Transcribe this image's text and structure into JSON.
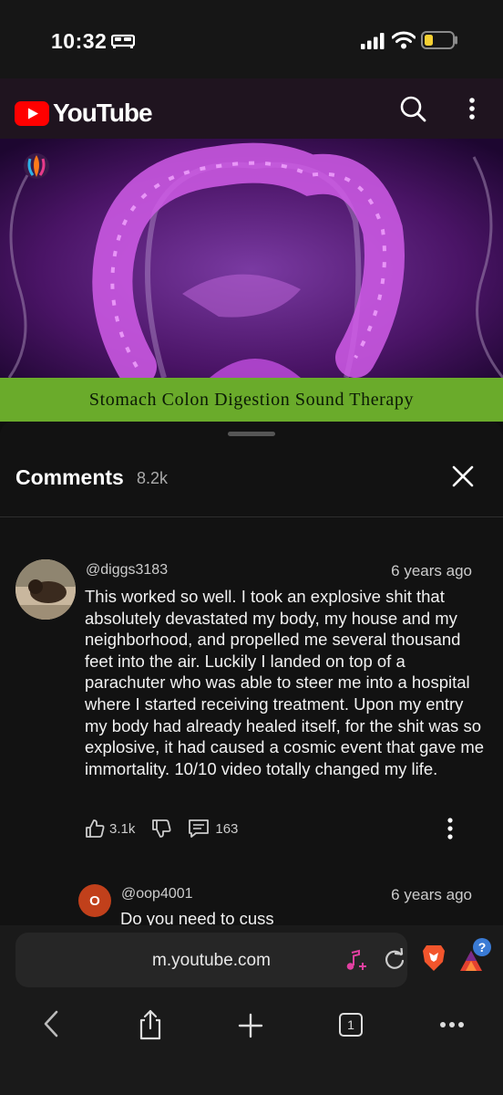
{
  "status_bar": {
    "time": "10:32"
  },
  "header": {
    "logo_text": "YouTube"
  },
  "video": {
    "banner_text": "Stomach Colon Digestion Sound Therapy"
  },
  "comments": {
    "title": "Comments",
    "count": "8.2k",
    "items": [
      {
        "author": "@diggs3183",
        "time": "6 years ago",
        "text": "This worked so well. I took an explosive shit that absolutely devastated my body, my house and my neighborhood, and propelled me several thousand feet into the air. Luckily I landed on top of a parachuter who was able to steer me into a hospital where I started receiving treatment. Upon my entry my body had already healed itself, for the shit was so explosive, it had caused a cosmic event that gave me immortality. 10/10 video totally changed my life.",
        "likes": "3.1k",
        "replies": "163"
      },
      {
        "author": "@oop4001",
        "avatar_letter": "O",
        "time": "6 years ago",
        "text": "Do you need to cuss"
      }
    ]
  },
  "browser": {
    "url": "m.youtube.com",
    "tab_count": "1",
    "badge": "?"
  },
  "colors": {
    "accent_green": "#6aab2b",
    "youtube_red": "#ff0000",
    "reply_avatar": "#c1401b"
  }
}
